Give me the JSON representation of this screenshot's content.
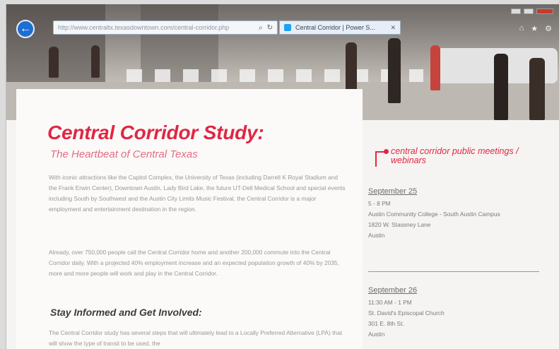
{
  "browser": {
    "url": "http://www.centraltx.texasdowntown.com/central-corridor.php",
    "tab_label": "Central Corridor | Power S...",
    "tab_close": "✕",
    "refresh_icon": "refresh-icon",
    "search_icon": "search-icon"
  },
  "main": {
    "title": "Central Corridor Study:",
    "subtitle": "The Heartbeat of Central Texas",
    "paragraph1": "With iconic attractions like the Capitol Complex, the University of Texas (including Darrell K Royal Stadium and the Frank Erwin Center), Downtown Austin, Lady Bird Lake, the future UT-Dell Medical School and special events including South by Southwest and the Austin City Limits Music Festival, the Central Corridor is a major employment and entertainment destination in the region.",
    "paragraph2": "Already, over 750,000 people call the Central Corridor home and another 200,000 commute into the Central Corridor daily. With a projected 40% employment increase and an expected population growth of 40% by 2035, more and more people will work and play in the Central Corridor.",
    "heading2": "Stay Informed and Get Involved:",
    "paragraph3": "The Central Corridor study has several steps that will ultimately lead to a Locally Preferred Alternative (LPA) that will show the type of transit to be used, the"
  },
  "sidebar": {
    "heading": "central corridor public meetings / webinars",
    "events": [
      {
        "date": "September 25",
        "time": "5 - 8 PM",
        "place": "Austin Community College - South Austin Campus",
        "address": "1820 W. Stassney Lane",
        "city": "Austin"
      },
      {
        "date": "September 26",
        "time": "11:30 AM - 1 PM",
        "place": "St. David's Episcopal Church",
        "address": "301 E. 8th St.",
        "city": "Austin"
      }
    ]
  }
}
